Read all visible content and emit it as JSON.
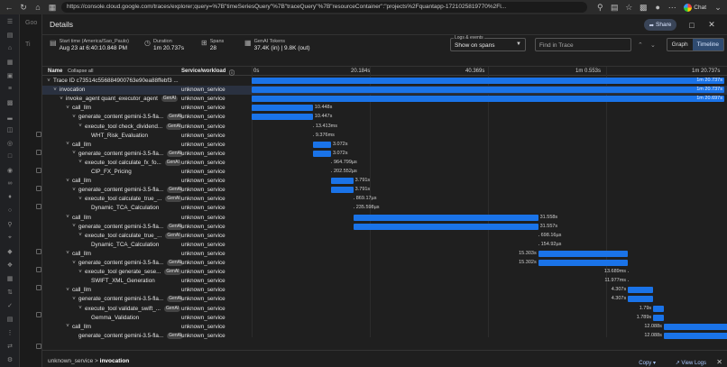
{
  "browser": {
    "url": "https://console.cloud.google.com/traces/explorer;query=%7B\"timeSeriesQuery\"%7B\"traceQuery\"%7B\"resourceContainer\":\"projects%2Fquantapp-1721025819770%2Fl...",
    "chat_label": "Chat"
  },
  "bg": {
    "app_label": "Goo",
    "tab_label": "Ti"
  },
  "panel": {
    "title": "Details",
    "share_label": "Share",
    "metrics": [
      {
        "title": "Start time (America/Sao_Paulo)",
        "value": "Aug 23 at 6:40:10.848 PM",
        "icon": "calendar-icon"
      },
      {
        "title": "Duration",
        "value": "1m 20.737s",
        "icon": "clock-icon"
      },
      {
        "title": "Spans",
        "value": "28",
        "icon": "spans-icon"
      },
      {
        "title": "GenAI Tokens",
        "value": "37.4K (in) | 9.8K (out)",
        "icon": "tokens-icon"
      }
    ],
    "logs_events": {
      "caption": "Logs & events",
      "value": "Show on spans"
    },
    "find_placeholder": "Find in Trace",
    "view_toggle": {
      "graph": "Graph",
      "timeline": "Timeline"
    }
  },
  "table": {
    "name_header": "Name",
    "collapse_all": "Collapse all",
    "service_header": "Service/workload",
    "ticks": [
      "0s",
      "20.184s",
      "40.369s",
      "1m 0.553s",
      "1m 20.737s"
    ]
  },
  "spans": [
    {
      "name": "Trace ID c73514c556884900763e90ea88ffebf3 ...",
      "service": "",
      "depth": 0,
      "caret": true,
      "badge": false,
      "start": 0,
      "dur": 80.737,
      "label": "1m 20.737s"
    },
    {
      "name": "invocation",
      "service": "unknown_service",
      "depth": 1,
      "caret": true,
      "badge": false,
      "start": 0,
      "dur": 80.737,
      "label": "1m 20.737s",
      "selected": true
    },
    {
      "name": "invoke_agent quant_executor_agent",
      "service": "unknown_service",
      "depth": 2,
      "caret": true,
      "badge": true,
      "start": 0,
      "dur": 80.737,
      "label": "1m 20.697s"
    },
    {
      "name": "call_llm",
      "service": "unknown_service",
      "depth": 3,
      "caret": true,
      "badge": false,
      "start": 0,
      "dur": 10.448,
      "label": "10.448s"
    },
    {
      "name": "generate_content gemini-3.5-fla...",
      "service": "unknown_service",
      "depth": 4,
      "caret": true,
      "badge": true,
      "start": 0,
      "dur": 10.447,
      "label": "10.447s"
    },
    {
      "name": "execute_tool check_dividend...",
      "service": "unknown_service",
      "depth": 5,
      "caret": true,
      "badge": true,
      "start": 10.45,
      "dur": 0.013,
      "label": "13.413ms",
      "thin": true
    },
    {
      "name": "WHT_Risk_Evaluation",
      "service": "unknown_service",
      "depth": 6,
      "caret": false,
      "badge": false,
      "start": 10.45,
      "dur": 0.009,
      "label": "9.376ms",
      "thin": true
    },
    {
      "name": "call_llm",
      "service": "unknown_service",
      "depth": 3,
      "caret": true,
      "badge": false,
      "start": 10.48,
      "dur": 3.072,
      "label": "3.072s"
    },
    {
      "name": "generate_content gemini-3.5-fla...",
      "service": "unknown_service",
      "depth": 4,
      "caret": true,
      "badge": true,
      "start": 10.48,
      "dur": 3.072,
      "label": "3.072s"
    },
    {
      "name": "execute_tool calculate_fx_fo...",
      "service": "unknown_service",
      "depth": 5,
      "caret": true,
      "badge": true,
      "start": 13.56,
      "dur": 0.0009,
      "label": "964.799µs",
      "thin": true
    },
    {
      "name": "CIP_FX_Pricing",
      "service": "unknown_service",
      "depth": 6,
      "caret": false,
      "badge": false,
      "start": 13.56,
      "dur": 0.0002,
      "label": "202.552µs",
      "thin": true
    },
    {
      "name": "call_llm",
      "service": "unknown_service",
      "depth": 3,
      "caret": true,
      "badge": false,
      "start": 13.57,
      "dur": 3.791,
      "label": "3.791s"
    },
    {
      "name": "generate_content gemini-3.5-fla...",
      "service": "unknown_service",
      "depth": 4,
      "caret": true,
      "badge": true,
      "start": 13.57,
      "dur": 3.791,
      "label": "3.791s"
    },
    {
      "name": "execute_tool calculate_true_...",
      "service": "unknown_service",
      "depth": 5,
      "caret": true,
      "badge": true,
      "start": 17.37,
      "dur": 0.0009,
      "label": "869.17µs",
      "thin": true
    },
    {
      "name": "Dynamic_TCA_Calculation",
      "service": "unknown_service",
      "depth": 6,
      "caret": false,
      "badge": false,
      "start": 17.37,
      "dur": 0.0002,
      "label": "235.598µs",
      "thin": true
    },
    {
      "name": "call_llm",
      "service": "unknown_service",
      "depth": 3,
      "caret": true,
      "badge": false,
      "start": 17.38,
      "dur": 31.558,
      "label": "31.558s"
    },
    {
      "name": "generate_content gemini-3.5-fla...",
      "service": "unknown_service",
      "depth": 4,
      "caret": true,
      "badge": true,
      "start": 17.38,
      "dur": 31.557,
      "label": "31.557s"
    },
    {
      "name": "execute_tool calculate_true_...",
      "service": "unknown_service",
      "depth": 5,
      "caret": true,
      "badge": true,
      "start": 48.94,
      "dur": 0.0007,
      "label": "698.16µs",
      "thin": true
    },
    {
      "name": "Dynamic_TCA_Calculation",
      "service": "unknown_service",
      "depth": 6,
      "caret": false,
      "badge": false,
      "start": 48.94,
      "dur": 0.0002,
      "label": "154.92µs",
      "thin": true
    },
    {
      "name": "call_llm",
      "service": "unknown_service",
      "depth": 3,
      "caret": true,
      "badge": false,
      "start": 48.95,
      "dur": 15.303,
      "label": "15.303s",
      "left_label": true
    },
    {
      "name": "generate_content gemini-3.5-fla...",
      "service": "unknown_service",
      "depth": 4,
      "caret": true,
      "badge": true,
      "start": 48.95,
      "dur": 15.302,
      "label": "15.302s",
      "left_label": true
    },
    {
      "name": "execute_tool generate_sese...",
      "service": "unknown_service",
      "depth": 5,
      "caret": true,
      "badge": true,
      "start": 64.26,
      "dur": 0.013,
      "label": "13.689ms",
      "thin": true,
      "left_label": true
    },
    {
      "name": "SWIFT_XML_Generation",
      "service": "unknown_service",
      "depth": 6,
      "caret": false,
      "badge": false,
      "start": 64.26,
      "dur": 0.012,
      "label": "11.977ms",
      "thin": true,
      "left_label": true
    },
    {
      "name": "call_llm",
      "service": "unknown_service",
      "depth": 3,
      "caret": true,
      "badge": false,
      "start": 64.28,
      "dur": 4.307,
      "label": "4.307s",
      "left_label": true
    },
    {
      "name": "generate_content gemini-3.5-fla...",
      "service": "unknown_service",
      "depth": 4,
      "caret": true,
      "badge": true,
      "start": 64.28,
      "dur": 4.307,
      "label": "4.307s",
      "left_label": true
    },
    {
      "name": "execute_tool validate_swift_...",
      "service": "unknown_service",
      "depth": 5,
      "caret": true,
      "badge": true,
      "start": 68.59,
      "dur": 1.79,
      "label": "1.79s",
      "left_label": true
    },
    {
      "name": "Gemma_Validation",
      "service": "unknown_service",
      "depth": 6,
      "caret": false,
      "badge": false,
      "start": 68.59,
      "dur": 1.789,
      "label": "1.789s",
      "left_label": true
    },
    {
      "name": "call_llm",
      "service": "unknown_service",
      "depth": 3,
      "caret": true,
      "badge": false,
      "start": 70.4,
      "dur": 12.088,
      "label": "12.088s",
      "left_label": true
    },
    {
      "name": "generate_content gemini-3.5-fla...",
      "service": "unknown_service",
      "depth": 4,
      "caret": false,
      "badge": true,
      "start": 70.4,
      "dur": 12.088,
      "label": "12.088s",
      "left_label": true
    }
  ],
  "timeline_max": 80.737,
  "badge_label": "GenAI",
  "footer": {
    "crumb_service": "unknown_service",
    "crumb_sep": ">",
    "crumb_span": "invocation",
    "copy_label": "Copy",
    "view_logs_label": "View Logs"
  }
}
